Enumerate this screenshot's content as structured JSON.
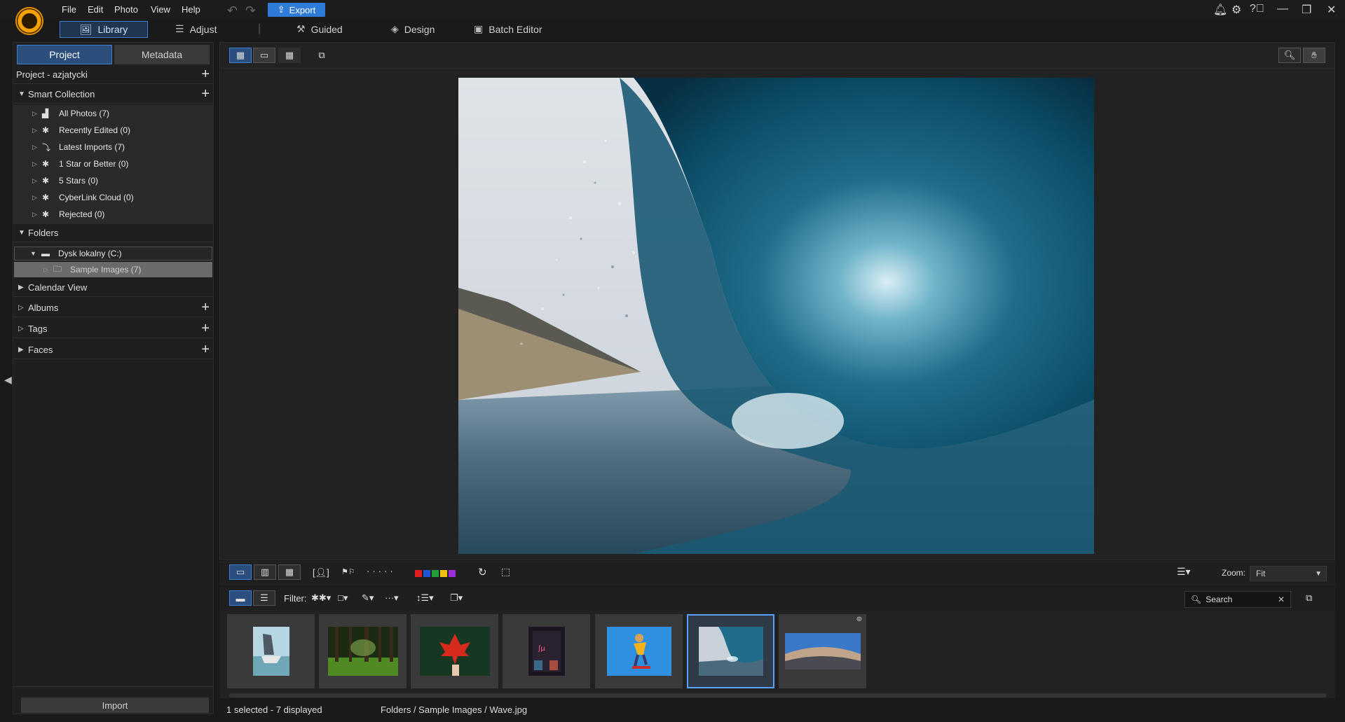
{
  "menu": [
    "File",
    "Edit",
    "Photo",
    "View",
    "Help"
  ],
  "export_label": "Export",
  "modules": {
    "library": "Library",
    "adjust": "Adjust",
    "guided": "Guided",
    "design": "Design",
    "batch": "Batch Editor"
  },
  "panel_tabs": {
    "project": "Project",
    "metadata": "Metadata"
  },
  "project_name": "Project - azjatycki",
  "smart_collection": {
    "label": "Smart Collection",
    "items": [
      "All Photos (7)",
      "Recently Edited (0)",
      "Latest Imports (7)",
      "1 Star or Better (0)",
      "5 Stars (0)",
      "CyberLink Cloud (0)",
      "Rejected (0)"
    ]
  },
  "folders": {
    "label": "Folders",
    "drive": "Dysk lokalny (C:)",
    "subfolder": "Sample Images (7)"
  },
  "sections": {
    "calendar": "Calendar View",
    "albums": "Albums",
    "tags": "Tags",
    "faces": "Faces"
  },
  "import_label": "Import",
  "filter_label": "Filter:",
  "zoom": {
    "label": "Zoom:",
    "value": "Fit"
  },
  "search_placeholder": "Search",
  "status": {
    "selection": "1 selected - 7 displayed",
    "path": "Folders / Sample Images / Wave.jpg"
  },
  "color_labels": [
    "#e01e1e",
    "#2255d8",
    "#22a03a",
    "#f2c012",
    "#9b30d8"
  ],
  "accent": "#3f7fd0"
}
